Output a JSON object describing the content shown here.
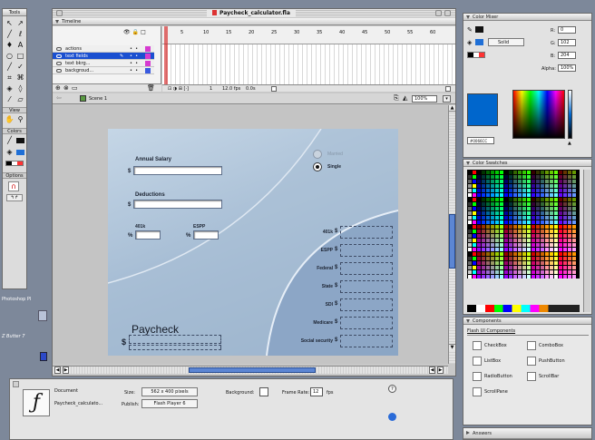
{
  "window": {
    "title": "Paycheck_calculator.fla"
  },
  "tools": {
    "title": "Tools",
    "sections": [
      "View",
      "Colors",
      "Options"
    ]
  },
  "timeline": {
    "title": "Timeline",
    "layers": [
      {
        "name": "actions",
        "color": "#d63ad0",
        "selected": false
      },
      {
        "name": "text fields",
        "color": "#d63ad0",
        "selected": true
      },
      {
        "name": "text bkrg...",
        "color": "#d63ad0",
        "selected": false
      },
      {
        "name": "backgroud...",
        "color": "#3a5be0",
        "selected": false
      }
    ],
    "frame_numbers": [
      "5",
      "10",
      "15",
      "20",
      "25",
      "30",
      "35",
      "40",
      "45",
      "50",
      "55",
      "60"
    ],
    "status": {
      "frame": "1",
      "fps": "12.0 fps",
      "time": "0.0s"
    }
  },
  "scene": {
    "label": "Scene 1",
    "zoom": "100%"
  },
  "calculator": {
    "annual_salary_label": "Annual Salary",
    "deductions_label": "Deductions",
    "k401_label": "401k",
    "espp_label": "ESPP",
    "dollar": "$",
    "percent": "%",
    "married": "Married",
    "single": "Single",
    "paycheck_label": "Paycheck",
    "outputs": [
      "401k",
      "ESPP",
      "Federal",
      "State",
      "SDI",
      "Medicare",
      "Social security"
    ]
  },
  "properties": {
    "type_label": "Document",
    "filename": "Paycheck_calculato...",
    "size_label": "Size:",
    "size_value": "562 x 400 pixels",
    "publish_label": "Publish:",
    "publish_value": "Flash Player 6",
    "background_label": "Background:",
    "framerate_label": "Frame Rate:",
    "framerate_value": "12",
    "fps": "fps"
  },
  "color_mixer": {
    "title": "Color Mixer",
    "fill_type": "Solid",
    "r_label": "R:",
    "r_value": "0",
    "g_label": "G:",
    "g_value": "102",
    "b_label": "B:",
    "b_value": "204",
    "alpha_label": "Alpha:",
    "alpha_value": "100%",
    "hex": "#0066CC",
    "swatch_color": "#0066cc"
  },
  "color_swatches": {
    "title": "Color Swatches"
  },
  "components": {
    "title": "Components",
    "set": "Flash UI Components",
    "items": [
      "CheckBox",
      "ComboBox",
      "ListBox",
      "PushButton",
      "RadioButton",
      "ScrollBar",
      "ScrollPane"
    ]
  },
  "answers": {
    "title": "Answers"
  },
  "desktop": {
    "label1": "Photoshop Pl",
    "label2": "Z Butter 7"
  }
}
